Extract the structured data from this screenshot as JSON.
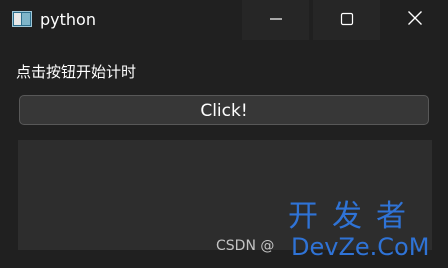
{
  "window": {
    "title": "python",
    "icon": "python-app-icon",
    "controls": {
      "minimize": "minimize-icon",
      "maximize": "maximize-icon",
      "close": "close-icon"
    }
  },
  "content": {
    "label": "点击按钮开始计时",
    "button_label": "Click!",
    "display_text": ""
  },
  "watermark": {
    "csdn": "CSDN @",
    "site_name": "开发者",
    "site_url": "DevZe.CoM"
  },
  "colors": {
    "background": "#202020",
    "button": "#373737",
    "display": "#2d2d2d",
    "watermark": "#2f73d6"
  }
}
